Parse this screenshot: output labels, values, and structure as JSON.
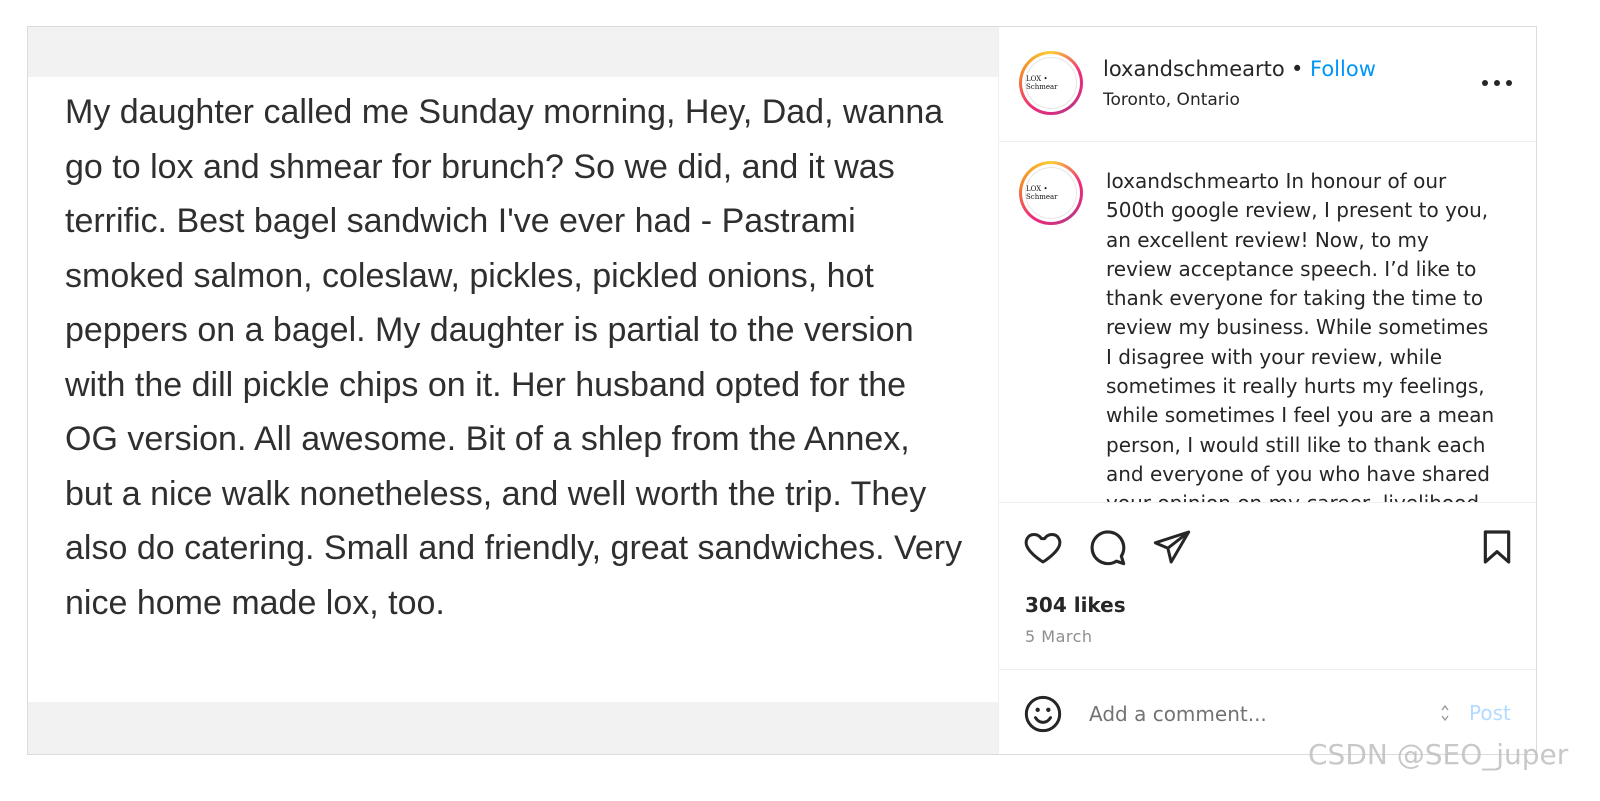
{
  "post": {
    "review_text": "My daughter called me Sunday morning, Hey, Dad, wanna go to lox and shmear for brunch? So we did, and it was terrific. Best bagel sandwich I've ever had - Pastrami smoked salmon, coleslaw, pickles, pickled onions, hot peppers on a bagel. My daughter is partial to the version with the dill pickle chips on it. Her husband opted for the OG version. All awesome. Bit of a shlep from the Annex, but a nice walk nonetheless, and well worth the trip. They also do catering. Small and friendly, great sandwiches. Very nice home made lox, too."
  },
  "header": {
    "username": "loxandschmearto",
    "separator": "•",
    "follow_label": "Follow",
    "location": "Toronto, Ontario",
    "avatar_text": "LOX • Schmear"
  },
  "caption": {
    "username": "loxandschmearto",
    "text": "In honour of our 500th google review, I present to you, an excellent review! Now, to my review acceptance speech. I’d like to thank everyone for taking the time to review my business. While sometimes I disagree with your review, while sometimes it really hurts my feelings, while sometimes I feel you are a mean person, I would still like to thank each and everyone of you who have shared your opinion on my career, livelihood"
  },
  "engagement": {
    "likes": "304 likes",
    "date": "5 March"
  },
  "comment": {
    "placeholder": "Add a comment...",
    "post_label": "Post"
  },
  "watermark": "CSDN @SEO_juper",
  "colors": {
    "link": "#0095f6",
    "post_disabled": "#b3dbff",
    "text": "#262626",
    "muted": "#8e8e8e"
  },
  "icons": [
    "more-icon",
    "heart-icon",
    "comment-icon",
    "share-icon",
    "bookmark-icon",
    "emoji-icon"
  ]
}
